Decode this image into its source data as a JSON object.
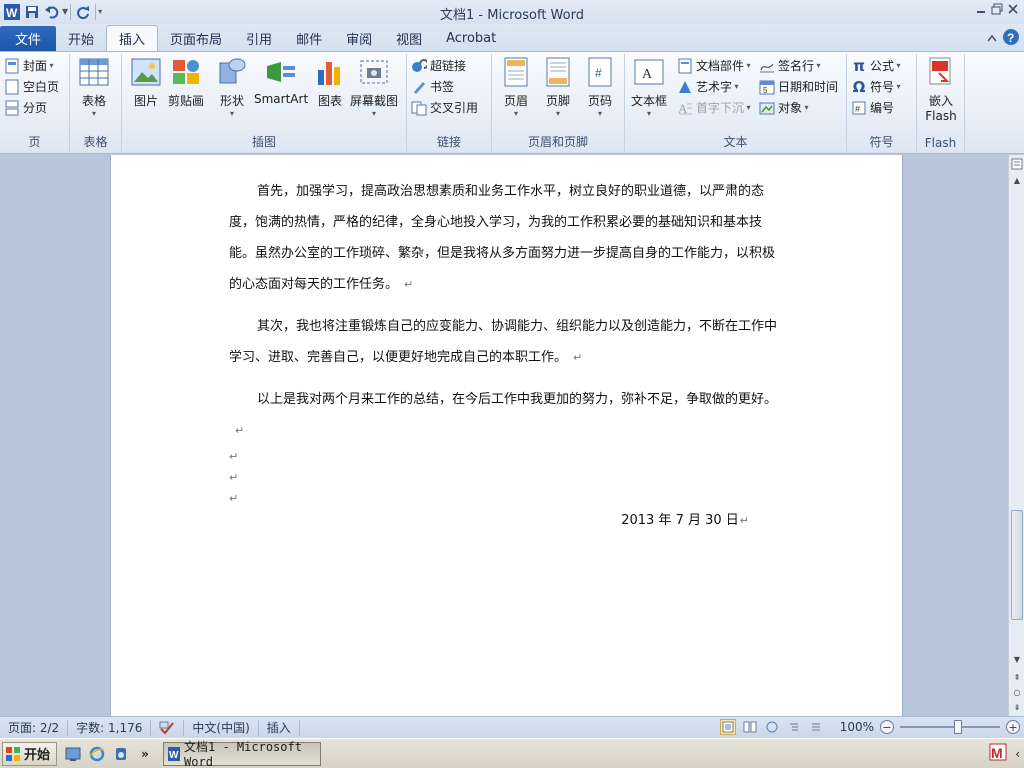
{
  "window": {
    "title": "文档1  -  Microsoft Word"
  },
  "tabs": [
    {
      "label": "文件"
    },
    {
      "label": "开始"
    },
    {
      "label": "插入"
    },
    {
      "label": "页面布局"
    },
    {
      "label": "引用"
    },
    {
      "label": "邮件"
    },
    {
      "label": "审阅"
    },
    {
      "label": "视图"
    },
    {
      "label": "Acrobat"
    }
  ],
  "ribbon": {
    "page_group": {
      "label": "页",
      "cover": "封面",
      "blank": "空白页",
      "break": "分页"
    },
    "table_group": {
      "label": "表格",
      "table": "表格"
    },
    "illus_group": {
      "label": "插图",
      "picture": "图片",
      "clipart": "剪贴画",
      "shapes": "形状",
      "smartart": "SmartArt",
      "chart": "图表",
      "screenshot": "屏幕截图"
    },
    "links_group": {
      "label": "链接",
      "hyperlink": "超链接",
      "bookmark": "书签",
      "crossref": "交叉引用"
    },
    "hf_group": {
      "label": "页眉和页脚",
      "header": "页眉",
      "footer": "页脚",
      "pagenum": "页码"
    },
    "text_group": {
      "label": "文本",
      "textbox": "文本框",
      "quickparts": "文档部件",
      "wordart": "艺术字",
      "dropcap": "首字下沉",
      "signature": "签名行",
      "datetime": "日期和时间",
      "object": "对象"
    },
    "symbol_group": {
      "label": "符号",
      "equation": "公式",
      "symbol": "符号",
      "number": "编号"
    },
    "flash_group": {
      "label": "Flash",
      "embed": "嵌入",
      "flash": "Flash"
    }
  },
  "document": {
    "paragraphs": [
      "首先，加强学习，提高政治思想素质和业务工作水平，树立良好的职业道德，以严肃的态度，饱满的热情，严格的纪律，全身心地投入学习，为我的工作积累必要的基础知识和基本技能。虽然办公室的工作琐碎、繁杂，但是我将从多方面努力进一步提高自身的工作能力，以积极的心态面对每天的工作任务。",
      "其次，我也将注重锻炼自己的应变能力、协调能力、组织能力以及创造能力，不断在工作中学习、进取、完善自己，以便更好地完成自己的本职工作。",
      "以上是我对两个月来工作的总结，在今后工作中我更加的努力，弥补不足，争取做的更好。"
    ],
    "date": "2013 年 7 月 30 日",
    "para_mark": "↵"
  },
  "status": {
    "page": "页面: 2/2",
    "words": "字数: 1,176",
    "language": "中文(中国)",
    "mode": "插入",
    "zoom": "100%"
  },
  "taskbar": {
    "start": "开始",
    "window": "文档1 - Microsoft Word"
  }
}
